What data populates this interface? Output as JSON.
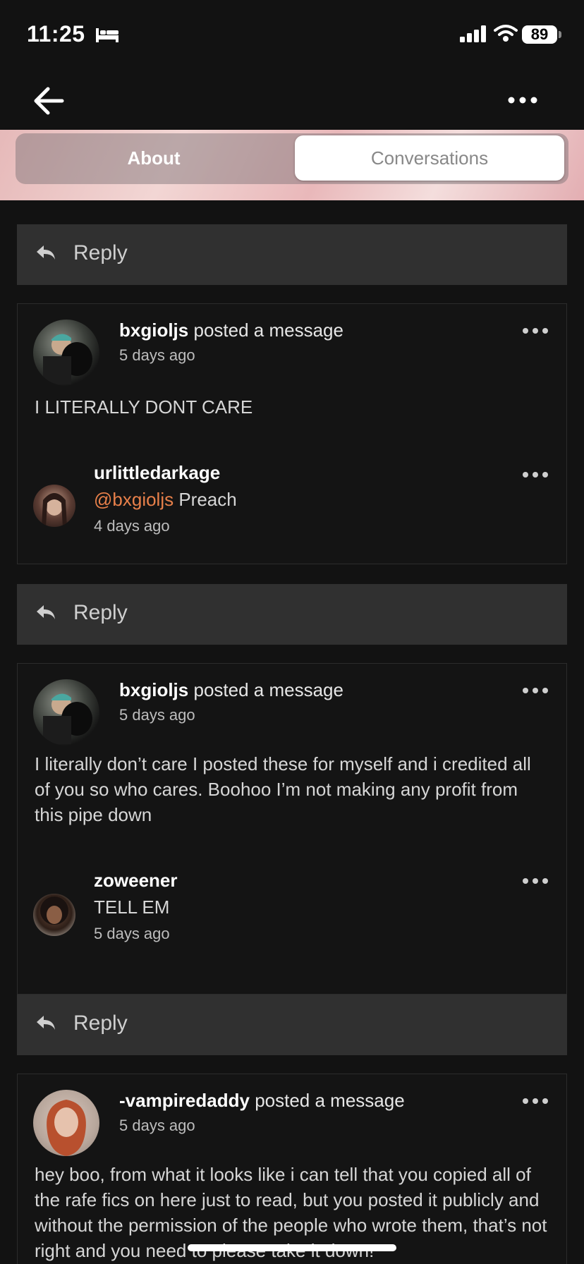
{
  "status": {
    "time": "11:25",
    "battery": "89"
  },
  "nav": {
    "back_icon": "arrow-left-icon",
    "more_icon": "more-horizontal-icon"
  },
  "tabs": [
    {
      "label": "About",
      "selected": false
    },
    {
      "label": "Conversations",
      "selected": true
    }
  ],
  "reply_label": "Reply",
  "posts": [
    {
      "user": "bxgioljs",
      "action": "posted a message",
      "time": "5 days ago",
      "body": "I LITERALLY DONT CARE",
      "comment": {
        "user": "urlittledarkage",
        "mention": "@bxgioljs",
        "text": "Preach",
        "time": "4 days ago"
      }
    },
    {
      "user": "bxgioljs",
      "action": "posted a message",
      "time": "5 days ago",
      "body": "I literally don’t care I posted these for myself and i credited all of you so who cares. Boohoo I’m not making any profit from this pipe down",
      "comment": {
        "user": "zoweener",
        "text": "TELL EM",
        "time": "5 days ago"
      }
    },
    {
      "user": "-vampiredaddy",
      "action": "posted a message",
      "time": "5 days ago",
      "body": "hey boo, from what it looks like i can tell that you copied all of the rafe fics on here just to read, but you posted it publicly and without the permission of the people who wrote them, that’s not right and you need to please take it down!"
    }
  ],
  "colors": {
    "background": "#121212",
    "reply_bar": "#303030",
    "mention": "#e8804a"
  }
}
